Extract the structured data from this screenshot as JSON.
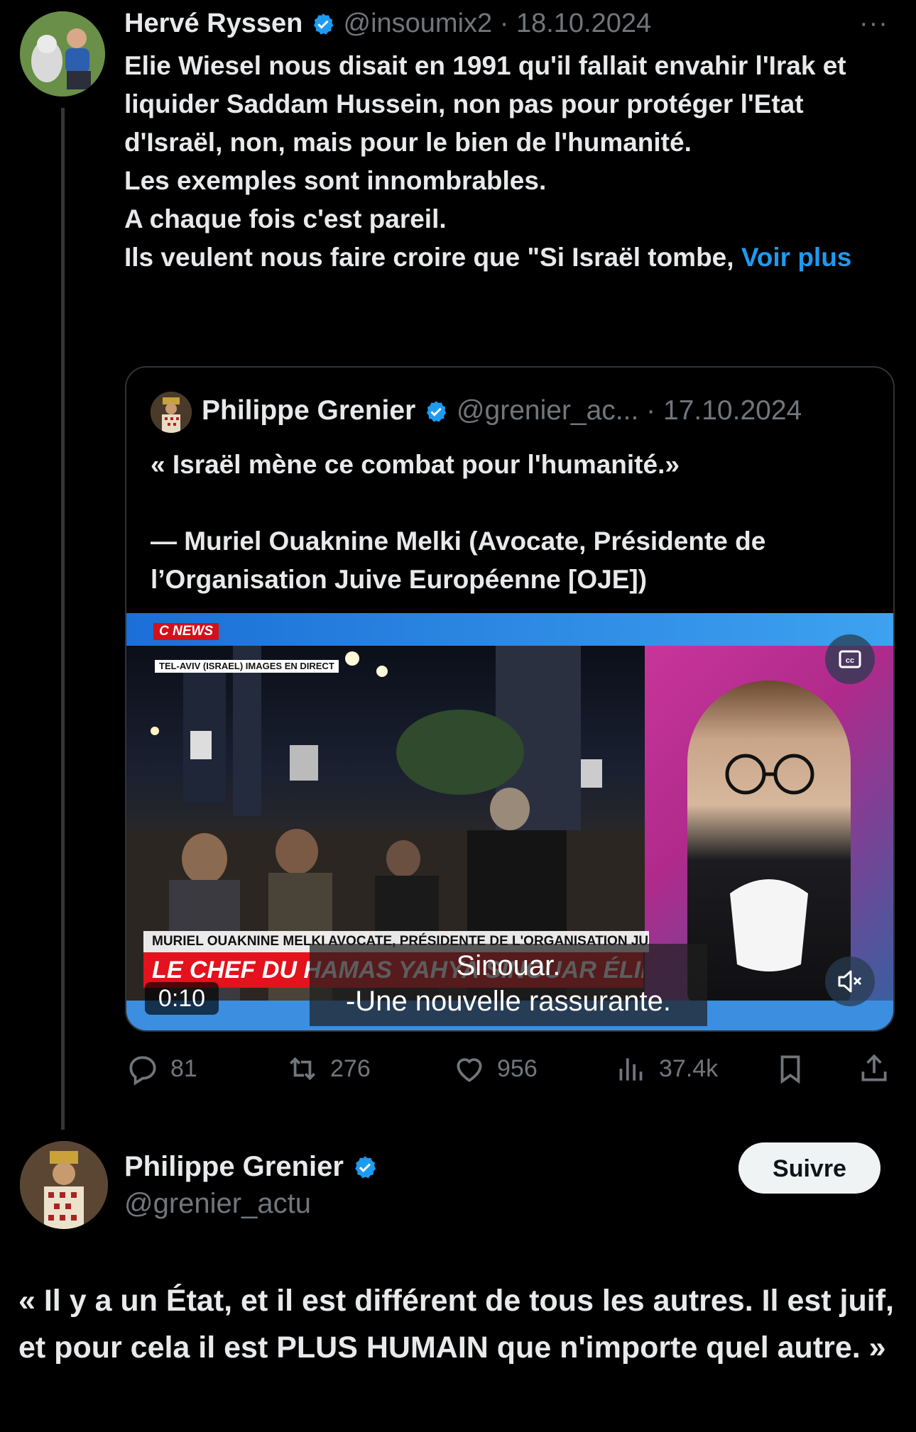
{
  "tweet": {
    "author_name": "Hervé Ryssen",
    "author_handle": "@insoumix2",
    "date_separator": "·",
    "date": "18.10.2024",
    "more_label": "···",
    "text": "Elie Wiesel nous disait en 1991 qu'il fallait envahir l'Irak et liquider Saddam Hussein, non pas pour protéger l'Etat d'Israël, non, mais pour le bien de l'humanité.\nLes exemples sont innombrables.\nA chaque fois c'est pareil.\nIls veulent nous faire croire que \"Si Israël tombe, ",
    "show_more": "Voir plus",
    "actions": {
      "replies": "81",
      "reposts": "276",
      "likes": "956",
      "views": "37.4k"
    }
  },
  "quote": {
    "author_name": "Philippe Grenier",
    "author_handle": "@grenier_ac...",
    "date_separator": "·",
    "date": "17.10.2024",
    "text": "« Israël mène ce combat pour l'humanité.»\n\n— Muriel Ouaknine Melki (Avocate, Présidente de l’Organisation Juive Européenne [OJE])",
    "video": {
      "channel_logo": "C NEWS",
      "location_tag": "TEL-AVIV (ISRAEL) IMAGES EN DIRECT",
      "lower_third_name": "MURIEL OUAKNINE MELKI  AVOCATE, PRÉSIDENTE DE L'ORGANISATION JUIVE EUROPÉENNE",
      "lower_third_headline": "LE CHEF DU HAMAS YAHYA SINOUAR ÉLIMINÉ",
      "caption_line1": "Sinouar.",
      "caption_line2": "-Une nouvelle rassurante.",
      "elapsed": "0:10"
    }
  },
  "reply": {
    "author_name": "Philippe Grenier",
    "author_handle": "@grenier_actu",
    "follow_label": "Suivre",
    "text": "« Il y a un État, et il est différent de tous les autres. Il est juif, et pour cela il est PLUS HUMAIN que n'importe quel autre. »"
  },
  "colors": {
    "background": "#000000",
    "text": "#e7e9ea",
    "muted": "#71767b",
    "link": "#1d9bf0",
    "verified": "#1d9bf0"
  }
}
